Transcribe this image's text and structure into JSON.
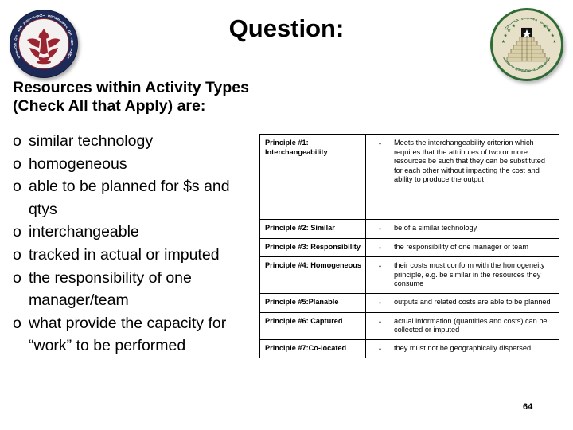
{
  "slide": {
    "title": "Question:",
    "page_number": "64",
    "heading_lines": [
      "Resources within Activity Types",
      "(Check All that Apply) are:"
    ],
    "bullet_marker": "o",
    "bullets": [
      "similar technology",
      "homogeneous",
      "able to be planned for $s and qtys",
      "interchangeable",
      "tracked in actual or imputed",
      "the responsibility of one manager/team",
      "what provide the capacity for “work” to be performed"
    ]
  },
  "seal_left": {
    "name": "office-of-the-assistant-secretary-of-the-army-seal",
    "ring_text": "OFFICE OF THE ASSISTANT SECRETARY OF THE ARMY",
    "ring_color": "#1d2a57",
    "emblem_color": "#9b2430"
  },
  "seal_right": {
    "name": "us-army-financial-management-comptroller-seal",
    "arc_top": "United States Army",
    "arc_bottom": "Financial Management & Comptroller",
    "border_color": "#2f6b35",
    "field_color": "#e7e0c9"
  },
  "table": {
    "bullet_glyph": "•",
    "rows": [
      {
        "label": "Principle #1: Interchangeability",
        "text": "Meets the interchangeability criterion which requires that the attributes of two or more resources be such that they can be substituted for each other without impacting the cost and ability to produce the output"
      },
      {
        "label": "Principle #2: Similar",
        "text": "be of a similar technology"
      },
      {
        "label": "Principle #3: Responsibility",
        "text": "the responsibility of one manager or team"
      },
      {
        "label": "Principle #4: Homogeneous",
        "text": "their costs must conform with the homogeneity principle, e.g. be similar in the resources they consume"
      },
      {
        "label": "Principle #5:Planable",
        "text": "outputs and related costs are able to be planned"
      },
      {
        "label": "Principle #6: Captured",
        "text": "actual information (quantities and costs) can be collected or imputed"
      },
      {
        "label": "Principle #7:Co-located",
        "text": "they must not be geographically dispersed"
      }
    ]
  }
}
